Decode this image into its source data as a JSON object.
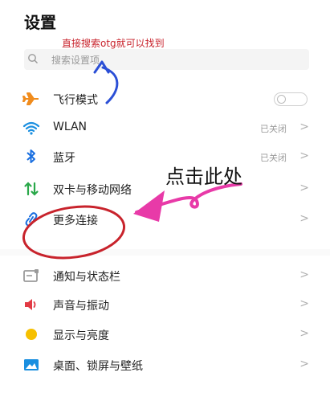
{
  "header": {
    "title": "设置"
  },
  "search": {
    "placeholder": "搜索设置项"
  },
  "annotation": {
    "note": "直接搜索otg就可以找到",
    "hint": "点击此处"
  },
  "settings": [
    {
      "label": "飞行模式",
      "icon": "airplane-icon",
      "control": "toggle",
      "on": false
    },
    {
      "label": "WLAN",
      "icon": "wifi-icon",
      "status": "已关闭"
    },
    {
      "label": "蓝牙",
      "icon": "bluetooth-icon",
      "status": "已关闭"
    },
    {
      "label": "双卡与移动网络",
      "icon": "dual-sim-icon"
    },
    {
      "label": "更多连接",
      "icon": "link-icon"
    },
    {
      "label": "通知与状态栏",
      "icon": "notification-icon"
    },
    {
      "label": "声音与振动",
      "icon": "speaker-icon"
    },
    {
      "label": "显示与亮度",
      "icon": "brightness-icon"
    },
    {
      "label": "桌面、锁屏与壁纸",
      "icon": "wallpaper-icon"
    }
  ],
  "colors": {
    "airplane": "#f08c1d",
    "wifi": "#1a8fe0",
    "bluetooth": "#1a6fe0",
    "sim": "#2aa84a",
    "link": "#1a6fe0",
    "speaker": "#e23a44",
    "brightness": "#f6c000",
    "wallpaper": "#1a8fe0",
    "annotation_red": "#c8232c",
    "annotation_pink": "#e83aa8",
    "annotation_blue": "#2b4fd6"
  }
}
